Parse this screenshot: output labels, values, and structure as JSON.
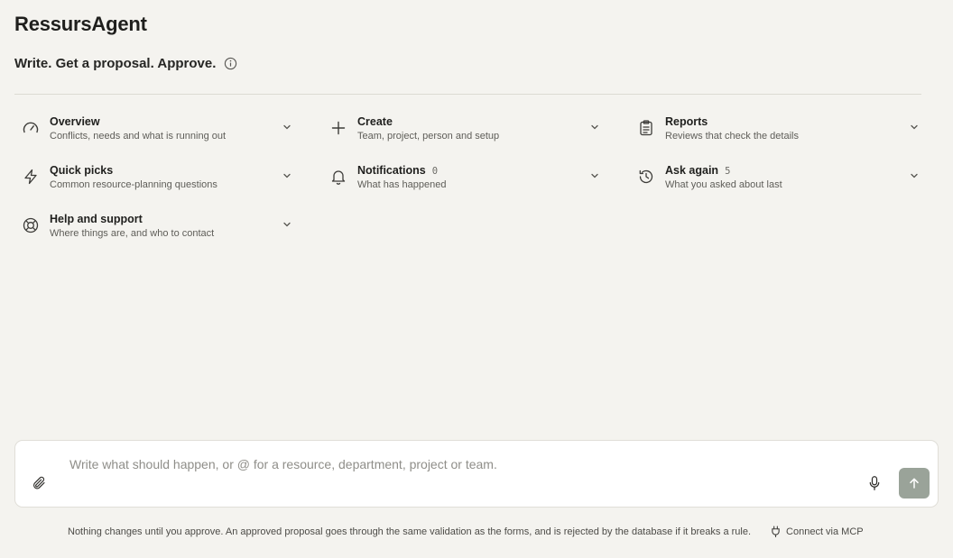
{
  "app": {
    "title": "RessursAgent"
  },
  "header": {
    "tagline": "Write. Get a proposal. Approve."
  },
  "menu": {
    "overview": {
      "title": "Overview",
      "subtitle": "Conflicts, needs and what is running out"
    },
    "create": {
      "title": "Create",
      "subtitle": "Team, project, person and setup"
    },
    "reports": {
      "title": "Reports",
      "subtitle": "Reviews that check the details"
    },
    "quick_picks": {
      "title": "Quick picks",
      "subtitle": "Common resource-planning questions"
    },
    "notifications": {
      "title": "Notifications",
      "count": "0",
      "subtitle": "What has happened"
    },
    "ask_again": {
      "title": "Ask again",
      "count": "5",
      "subtitle": "What you asked about last"
    },
    "help": {
      "title": "Help and support",
      "subtitle": "Where things are, and who to contact"
    }
  },
  "composer": {
    "placeholder": "Write what should happen, or @ for a resource, department, project or team.",
    "value": ""
  },
  "footer": {
    "note": "Nothing changes until you approve. An approved proposal goes through the same validation as the forms, and is rejected by the database if it breaks a rule.",
    "mcp_label": "Connect via MCP"
  },
  "icons": {
    "info": "info-icon",
    "overview": "gauge-icon",
    "create": "plus-icon",
    "reports": "clipboard-icon",
    "quick_picks": "lightning-icon",
    "notifications": "bell-icon",
    "ask_again": "history-icon",
    "help": "lifebuoy-icon",
    "attach": "paperclip-icon",
    "mic": "microphone-icon",
    "send": "arrow-up-icon",
    "mcp": "plug-icon"
  },
  "colors": {
    "background": "#f4f3ef",
    "send_button": "#9aa399",
    "text": "#1f1f1d"
  }
}
